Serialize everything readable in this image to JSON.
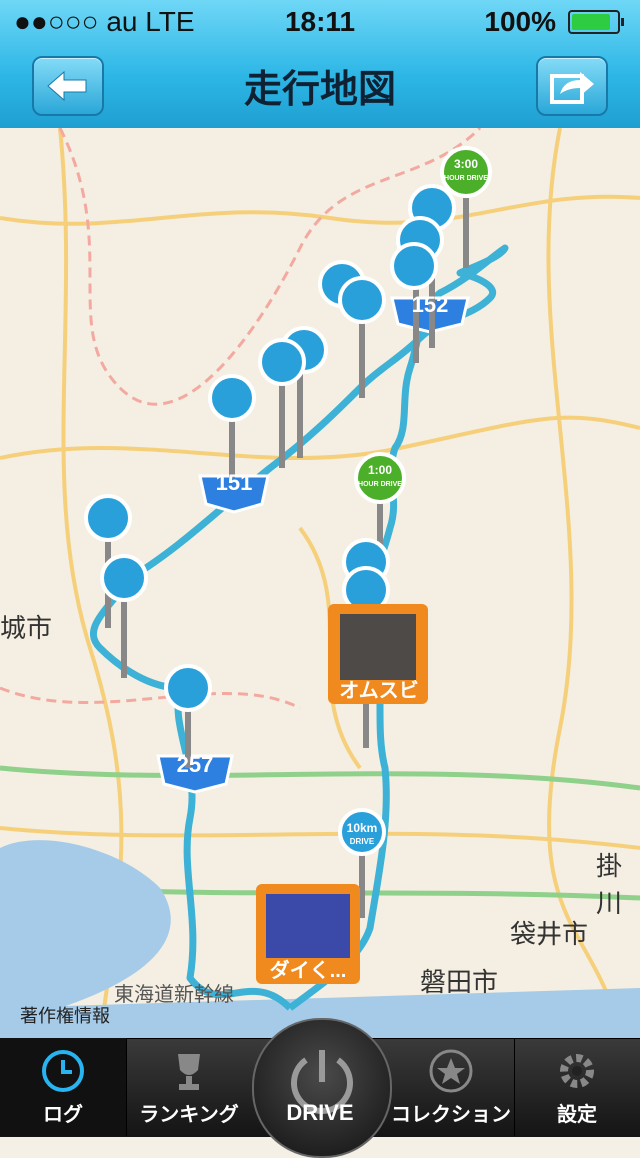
{
  "status": {
    "carrier": "●●○○○ au   LTE",
    "time": "18:11",
    "battery_pct": "100%"
  },
  "nav": {
    "title": "走行地図",
    "back_icon": "back-arrow-icon",
    "share_icon": "share-icon"
  },
  "map": {
    "labels": {
      "left_city": "城市",
      "kakegawa": "掛川",
      "fukuroi": "袋井市",
      "iwata": "磐田市",
      "shinkansen": "東海道新幹線"
    },
    "route_shields": [
      "152",
      "151",
      "257"
    ],
    "milestones": [
      {
        "top": "3:00",
        "bottom": "HOUR DRIVE"
      },
      {
        "top": "1:00",
        "bottom": "HOUR DRIVE"
      },
      {
        "top": "10km",
        "bottom": "DRIVE"
      }
    ],
    "photo_captions": [
      "オムスビ",
      "ダイく..."
    ],
    "copyright": "著作権情報",
    "colors": {
      "route": "#3db2d6",
      "pin": "#2aa0db",
      "milestone": "#4caf2a",
      "photo_frame": "#f18a1e"
    }
  },
  "tabs": [
    {
      "label": "ログ",
      "icon": "clock-icon",
      "active": true
    },
    {
      "label": "ランキング",
      "icon": "trophy-icon",
      "active": false
    },
    {
      "label": "DRIVE",
      "icon": "power-icon",
      "active": false
    },
    {
      "label": "コレクション",
      "icon": "star-icon",
      "active": false
    },
    {
      "label": "設定",
      "icon": "gear-icon",
      "active": false
    }
  ]
}
